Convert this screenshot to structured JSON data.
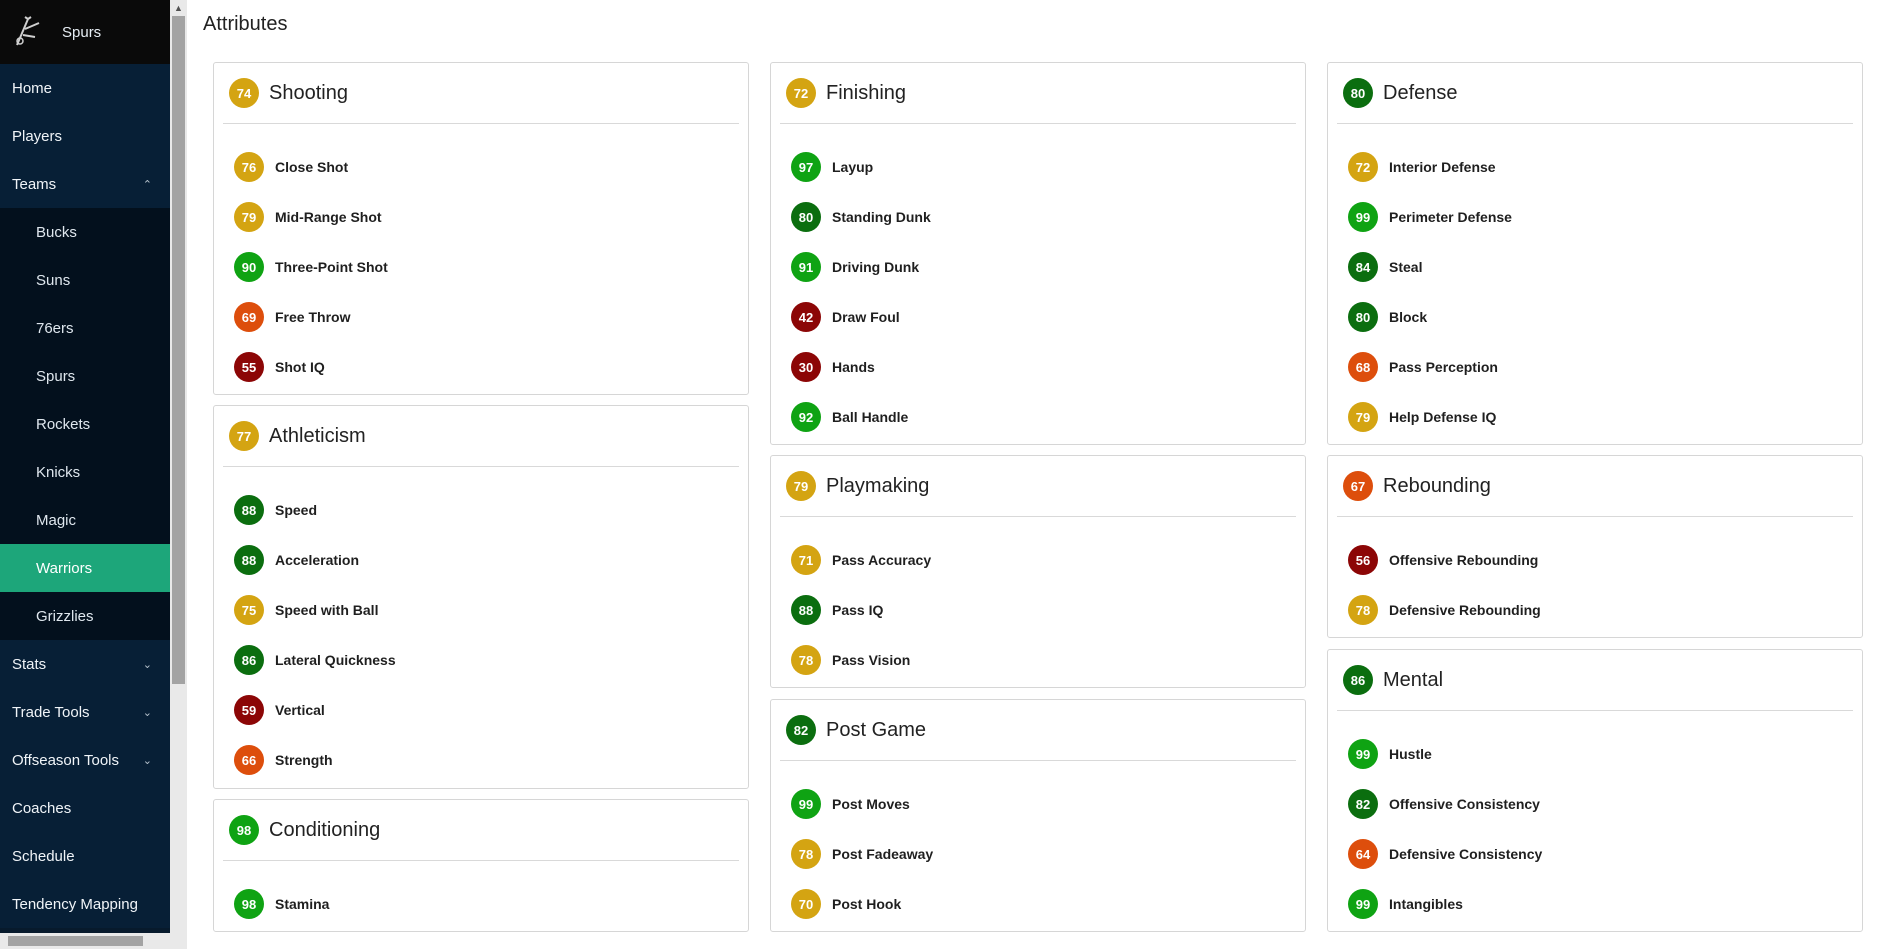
{
  "sidebar": {
    "team_name": "Spurs",
    "logo_icon": "spurs-logo-icon",
    "items": [
      {
        "label": "Home"
      },
      {
        "label": "Players"
      },
      {
        "label": "Teams",
        "expanded": true,
        "chevron": "⌃"
      },
      {
        "label": "Stats",
        "chevron": "⌄"
      },
      {
        "label": "Trade Tools",
        "chevron": "⌄"
      },
      {
        "label": "Offseason Tools",
        "chevron": "⌄"
      },
      {
        "label": "Coaches"
      },
      {
        "label": "Schedule"
      },
      {
        "label": "Tendency Mapping"
      }
    ],
    "teams": [
      "Bucks",
      "Suns",
      "76ers",
      "Spurs",
      "Rockets",
      "Knicks",
      "Magic",
      "Warriors",
      "Grizzlies"
    ],
    "active_team": "Warriors"
  },
  "main": {
    "title": "Attributes"
  },
  "colors": {
    "elite": "#0fa313",
    "great": "#0b6e0f",
    "good": "#d4a412",
    "average": "#dd4e0c",
    "poor": "#8c0606",
    "sidebar_bg": "#071a2c",
    "active": "#1da67a"
  },
  "cards": [
    {
      "id": "shooting",
      "title": "Shooting",
      "rating": 74,
      "attrs": [
        {
          "name": "Close Shot",
          "value": 76
        },
        {
          "name": "Mid-Range Shot",
          "value": 79
        },
        {
          "name": "Three-Point Shot",
          "value": 90
        },
        {
          "name": "Free Throw",
          "value": 69
        },
        {
          "name": "Shot IQ",
          "value": 55
        }
      ]
    },
    {
      "id": "athleticism",
      "title": "Athleticism",
      "rating": 77,
      "attrs": [
        {
          "name": "Speed",
          "value": 88
        },
        {
          "name": "Acceleration",
          "value": 88
        },
        {
          "name": "Speed with Ball",
          "value": 75
        },
        {
          "name": "Lateral Quickness",
          "value": 86
        },
        {
          "name": "Vertical",
          "value": 59
        },
        {
          "name": "Strength",
          "value": 66
        }
      ]
    },
    {
      "id": "conditioning",
      "title": "Conditioning",
      "rating": 98,
      "attrs": [
        {
          "name": "Stamina",
          "value": 98
        }
      ]
    },
    {
      "id": "finishing",
      "title": "Finishing",
      "rating": 72,
      "attrs": [
        {
          "name": "Layup",
          "value": 97
        },
        {
          "name": "Standing Dunk",
          "value": 80
        },
        {
          "name": "Driving Dunk",
          "value": 91
        },
        {
          "name": "Draw Foul",
          "value": 42
        },
        {
          "name": "Hands",
          "value": 30
        },
        {
          "name": "Ball Handle",
          "value": 92
        }
      ]
    },
    {
      "id": "playmaking",
      "title": "Playmaking",
      "rating": 79,
      "attrs": [
        {
          "name": "Pass Accuracy",
          "value": 71
        },
        {
          "name": "Pass IQ",
          "value": 88
        },
        {
          "name": "Pass Vision",
          "value": 78
        }
      ]
    },
    {
      "id": "post-game",
      "title": "Post Game",
      "rating": 82,
      "attrs": [
        {
          "name": "Post Moves",
          "value": 99
        },
        {
          "name": "Post Fadeaway",
          "value": 78
        },
        {
          "name": "Post Hook",
          "value": 70
        }
      ]
    },
    {
      "id": "defense",
      "title": "Defense",
      "rating": 80,
      "attrs": [
        {
          "name": "Interior Defense",
          "value": 72
        },
        {
          "name": "Perimeter Defense",
          "value": 99
        },
        {
          "name": "Steal",
          "value": 84
        },
        {
          "name": "Block",
          "value": 80
        },
        {
          "name": "Pass Perception",
          "value": 68
        },
        {
          "name": "Help Defense IQ",
          "value": 79
        }
      ]
    },
    {
      "id": "rebounding",
      "title": "Rebounding",
      "rating": 67,
      "attrs": [
        {
          "name": "Offensive Rebounding",
          "value": 56
        },
        {
          "name": "Defensive Rebounding",
          "value": 78
        }
      ]
    },
    {
      "id": "mental",
      "title": "Mental",
      "rating": 86,
      "attrs": [
        {
          "name": "Hustle",
          "value": 99
        },
        {
          "name": "Offensive Consistency",
          "value": 82
        },
        {
          "name": "Defensive Consistency",
          "value": 64
        },
        {
          "name": "Intangibles",
          "value": 99
        }
      ]
    }
  ]
}
